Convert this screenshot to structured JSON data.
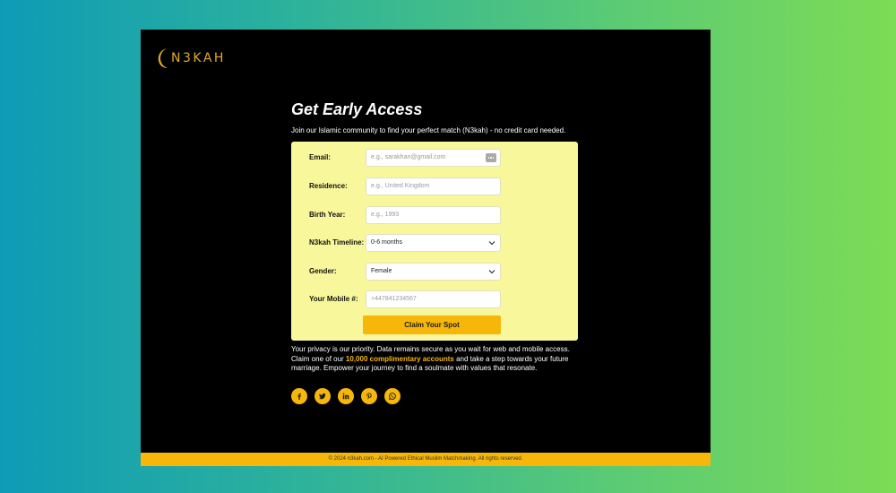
{
  "brand": {
    "name": "N3KAH"
  },
  "hero": {
    "title": "Get Early Access",
    "subtitle": "Join our Islamic community to find your perfect match (N3kah) - no credit card needed."
  },
  "form": {
    "email": {
      "label": "Email:",
      "placeholder": "e.g., sarakhan@gmail.com"
    },
    "residence": {
      "label": "Residence:",
      "placeholder": "e.g., United Kingdom"
    },
    "birth_year": {
      "label": "Birth Year:",
      "placeholder": "e.g., 1993"
    },
    "timeline": {
      "label": "N3kah Timeline:",
      "value": "0-6 months"
    },
    "gender": {
      "label": "Gender:",
      "value": "Female"
    },
    "mobile": {
      "label": "Your Mobile #:",
      "placeholder": "+447841234567"
    },
    "submit_label": "Claim Your Spot"
  },
  "privacy": {
    "before": "Your privacy is our priority. Data remains secure as you wait for web and mobile access. Claim one of our ",
    "highlight": "10,000 complimentary accounts",
    "after": " and take a step towards your future marriage. Empower your journey to find a soulmate with values that resonate."
  },
  "socials": [
    {
      "name": "facebook-icon",
      "glyph": "f"
    },
    {
      "name": "twitter-icon",
      "glyph": "twitter"
    },
    {
      "name": "linkedin-icon",
      "glyph": "in"
    },
    {
      "name": "pinterest-icon",
      "glyph": "p"
    },
    {
      "name": "whatsapp-icon",
      "glyph": "whatsapp"
    }
  ],
  "footer": {
    "text": "© 2024 n3kah.com - AI Powered Ethical Muslim Matchmaking. All rights reserved."
  },
  "colors": {
    "accent": "#f7b70a",
    "form_background": "#f8f79b",
    "page_background": "#000000",
    "logo": "#e2a82a"
  }
}
